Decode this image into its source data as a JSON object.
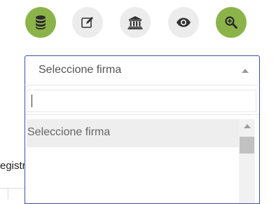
{
  "toolbar": {
    "icons": [
      {
        "name": "database-icon",
        "active": true
      },
      {
        "name": "edit-icon",
        "active": false
      },
      {
        "name": "bank-icon",
        "active": false
      },
      {
        "name": "eye-icon",
        "active": false
      },
      {
        "name": "zoom-in-icon",
        "active": true
      }
    ],
    "active_color": "#8cb349",
    "inactive_color": "#ececec"
  },
  "background": {
    "partial_text": "egistr"
  },
  "select": {
    "value": "Seleccione firma",
    "border_color": "#3d4fa8",
    "search_value": "",
    "options": [
      {
        "label": "Seleccione firma",
        "highlighted": true
      }
    ]
  }
}
